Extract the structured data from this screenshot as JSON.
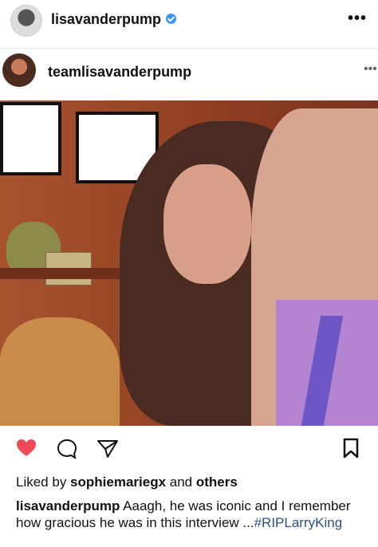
{
  "header": {
    "username": "lisavanderpump",
    "more_icon": "more-horizontal-icon"
  },
  "repost": {
    "username": "teamlisavanderpump",
    "more_icon": "more-horizontal-icon"
  },
  "photo": {
    "alt": "Photo"
  },
  "actions": {
    "like_icon": "heart-icon",
    "comment_icon": "comment-icon",
    "share_icon": "share-icon",
    "save_icon": "bookmark-icon",
    "like_color": "#ed4956"
  },
  "likes": {
    "prefix": "Liked by ",
    "user": "sophiemariegx",
    "joiner": " and ",
    "others": "others"
  },
  "caption": {
    "user": "lisavanderpump",
    "text": " Aaagh, he was iconic and I remember how gracious he was in this interview ...",
    "hashtag": "#RIPLarryKing"
  }
}
